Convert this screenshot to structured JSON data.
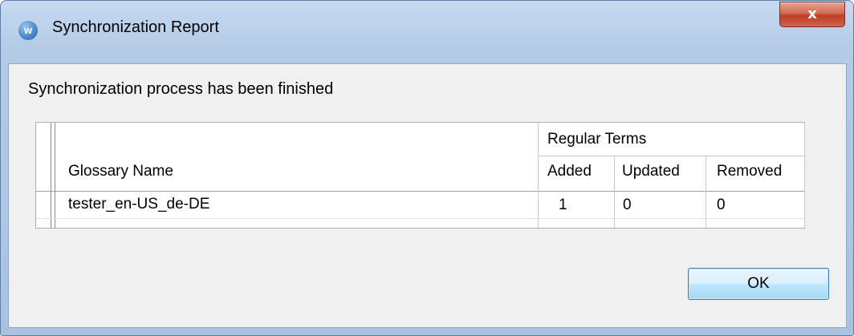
{
  "window": {
    "title": "Synchronization Report",
    "close_label": "x",
    "app_icon_glyph": "w"
  },
  "message": "Synchronization process has been finished",
  "table": {
    "group_header": "Regular Terms",
    "columns": [
      "Glossary Name",
      "Added",
      "Updated",
      "Removed"
    ],
    "rows": [
      {
        "glossary_name": "tester_en-US_de-DE",
        "added": "1",
        "updated": "0",
        "removed": "0"
      }
    ]
  },
  "buttons": {
    "ok_label": "OK"
  },
  "colors": {
    "close_button": "#c94a34",
    "ok_border": "#3c7fb1",
    "client_bg": "#f0f0f0"
  }
}
